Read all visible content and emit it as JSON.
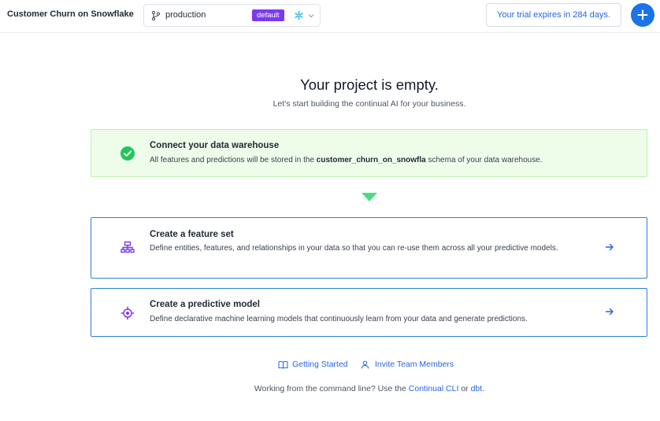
{
  "header": {
    "project_title": "Customer Churn on Snowflake",
    "branch": {
      "name": "production",
      "badge": "default"
    },
    "trial_text": "Your trial expires in 284 days."
  },
  "main": {
    "title": "Your project is empty.",
    "subtitle": "Let's start building the continual AI for your business.",
    "cards": [
      {
        "title": "Connect your data warehouse",
        "desc_prefix": "All features and predictions will be stored in the ",
        "desc_bold": "customer_churn_on_snowfla",
        "desc_suffix": " schema of your data warehouse.",
        "icon": "check-circle-icon",
        "status": "completed"
      },
      {
        "title": "Create a feature set",
        "desc": "Define entities, features, and relationships in your data so that you can re-use them across all your predictive models.",
        "icon": "feature-set-icon"
      },
      {
        "title": "Create a predictive model",
        "desc": "Define declarative machine learning models that continuously learn from your data and generate predictions.",
        "icon": "target-icon"
      }
    ],
    "links": {
      "getting_started": "Getting Started",
      "invite": "Invite Team Members"
    },
    "cli": {
      "prefix": "Working from the command line? Use the ",
      "cli_link": "Continual CLI",
      "middle": " or ",
      "dbt_link": "dbt",
      "suffix": "."
    }
  },
  "colors": {
    "accent": "#1a73e8",
    "success": "#22c55e",
    "badge": "#7c3aed",
    "purple_icon": "#7c3aed"
  }
}
